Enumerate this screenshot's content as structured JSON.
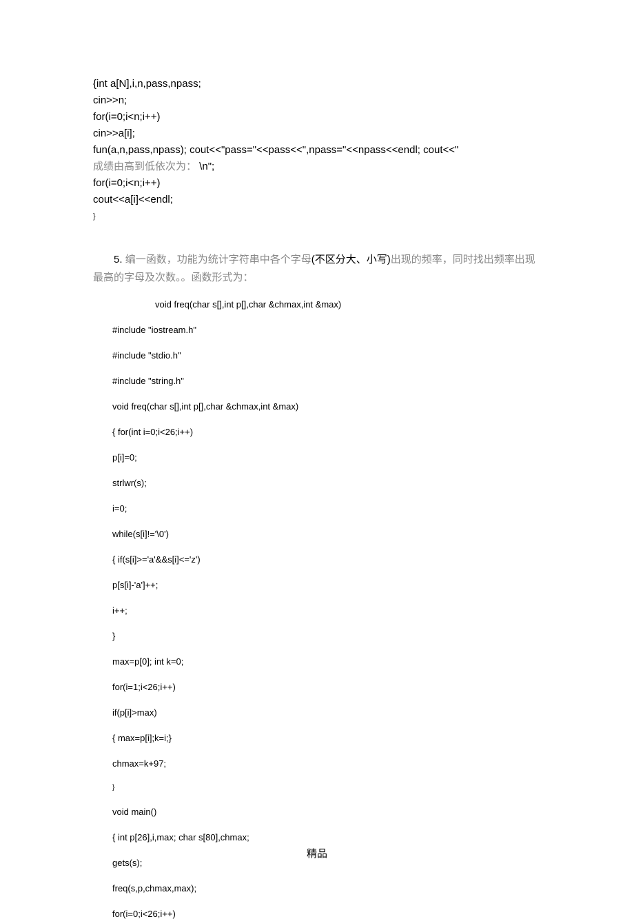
{
  "block1": {
    "l1": "{int a[N],i,n,pass,npass;",
    "l2": "cin>>n;",
    "l3": "for(i=0;i<n;i++)",
    "l4": "  cin>>a[i];",
    "l5a": " fun(a,n,pass,npass); cout<<\"pass=\"<<pass<<\",npass=\"<<npass<<endl; cout<<\"",
    "l5b_cn": "成绩由高到低依次为：",
    "l5c": "  \\n\";",
    "l6": "for(i=0;i<n;i++)",
    "l7": "  cout<<a[i]<<endl;",
    "l8": "}"
  },
  "para": {
    "num": "5. ",
    "text1": "编一函数，功能为统计字符串中各个字母",
    "paren": "(不区分大、小写)",
    "text2": "出现的频率，同时找出频率出现最高的字母及次数。",
    "text3": "。函数形式为："
  },
  "sig": "void freq(char s[],int p[],char &chmax,int &max)",
  "block2": {
    "l1": "#include \"iostream.h\"",
    "l2": "#include \"stdio.h\"",
    "l3": "#include \"string.h\"",
    "l4": "void freq(char s[],int p[],char &chmax,int &max)",
    "l5": "{ for(int i=0;i<26;i++)",
    "l6": "     p[i]=0;",
    "l7": "  strlwr(s);",
    "l8": "  i=0;",
    "l9": "  while(s[i]!='\\0')",
    "l10": "    { if(s[i]>='a'&&s[i]<='z')",
    "l11": "       p[s[i]-'a']++;",
    "l12": "       i++;",
    "l13": "}",
    "l14": "max=p[0]; int k=0;",
    "l15": "for(i=1;i<26;i++)",
    "l16": "if(p[i]>max)",
    "l17": "       { max=p[i];k=i;}",
    "l18": "chmax=k+97;",
    "l19": "}",
    "l20": "void main()",
    "l21": "{ int p[26],i,max; char s[80],chmax;",
    "l22": "gets(s);",
    "l23": "freq(s,p,chmax,max);",
    "l24": "for(i=0;i<26;i++)"
  },
  "footer": "精品"
}
